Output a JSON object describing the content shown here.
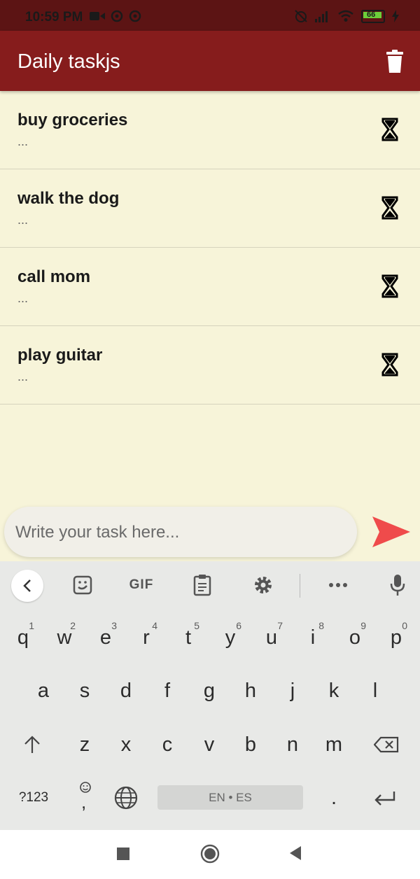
{
  "status_bar": {
    "time": "10:59 PM",
    "left_icons": [
      "video-camera-icon",
      "sync-icon",
      "sync-icon"
    ],
    "right_icons": [
      "alarm-off-icon",
      "signal-icon",
      "wifi-icon",
      "battery-icon"
    ],
    "battery_level": "66"
  },
  "app_bar": {
    "title": "Daily taskjs",
    "action_icon": "trash-icon",
    "color": "#861c1c"
  },
  "tasks": [
    {
      "title": "buy groceries",
      "subtitle": "...",
      "icon": "hourglass-icon"
    },
    {
      "title": "walk the dog",
      "subtitle": "...",
      "icon": "hourglass-icon"
    },
    {
      "title": "call mom",
      "subtitle": "...",
      "icon": "hourglass-icon"
    },
    {
      "title": "play guitar",
      "subtitle": "...",
      "icon": "hourglass-icon"
    }
  ],
  "input": {
    "placeholder": "Write your task here...",
    "value": "",
    "send_icon": "send-icon",
    "send_color": "#ef4b4b"
  },
  "keyboard": {
    "toolbar": [
      "back-chevron-icon",
      "sticker-icon",
      "GIF",
      "clipboard-icon",
      "settings-icon",
      "more-icon",
      "microphone-icon"
    ],
    "row1": [
      "q",
      "w",
      "e",
      "r",
      "t",
      "y",
      "u",
      "i",
      "o",
      "p"
    ],
    "row1_hints": [
      "1",
      "2",
      "3",
      "4",
      "5",
      "6",
      "7",
      "8",
      "9",
      "0"
    ],
    "row2": [
      "a",
      "s",
      "d",
      "f",
      "g",
      "h",
      "j",
      "k",
      "l"
    ],
    "row3": [
      "z",
      "x",
      "c",
      "v",
      "b",
      "n",
      "m"
    ],
    "symbols_key": "?123",
    "emoji_comma": ",",
    "space_label": "EN • ES",
    "period": "."
  },
  "nav_bar": {
    "buttons": [
      "recents-icon",
      "home-icon",
      "back-icon"
    ]
  },
  "colors": {
    "background": "#f7f4d9",
    "status_bar": "#5c1414",
    "app_bar": "#861c1c",
    "send": "#ef4b4b"
  }
}
